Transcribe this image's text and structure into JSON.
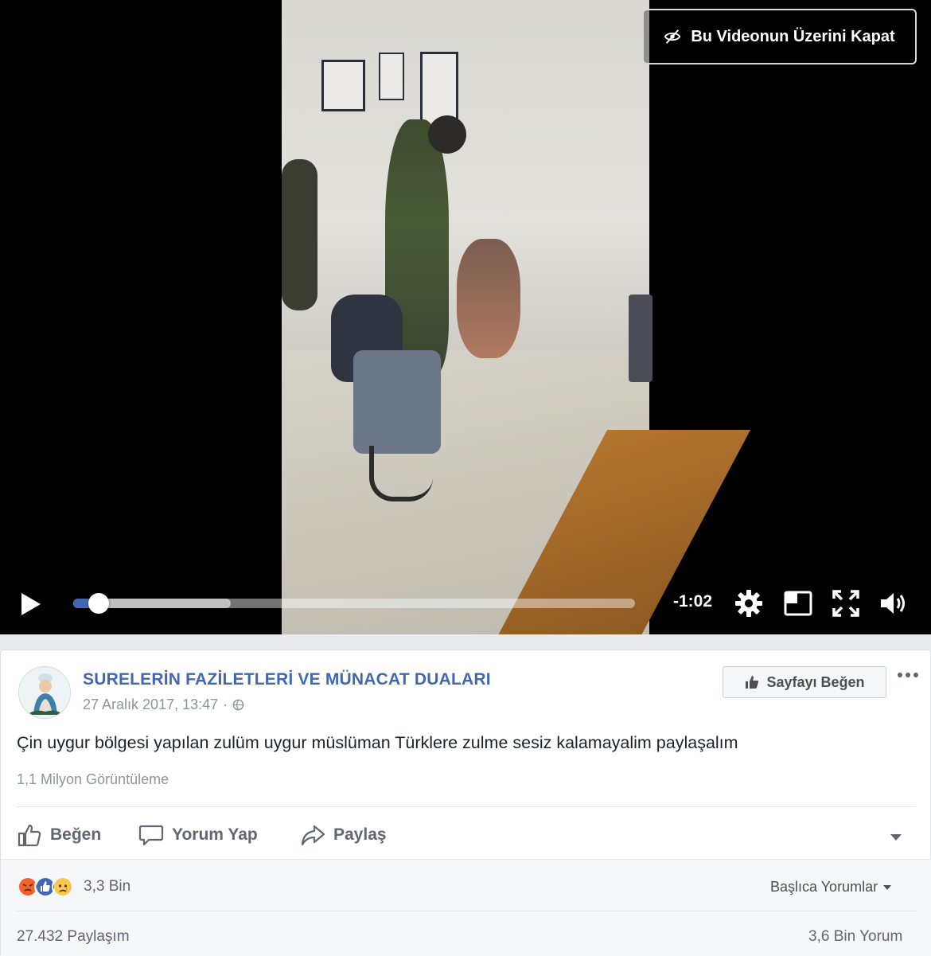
{
  "video": {
    "hide_label": "Bu Videonun Üzerini Kapat",
    "remaining_time": "-1:02",
    "progress_fraction": 0.045,
    "buffered_fraction": 0.28,
    "controls": [
      "play-icon",
      "gear-icon",
      "pip-icon",
      "fullscreen-icon",
      "volume-icon"
    ]
  },
  "post": {
    "page_name": "SURELERİN FAZİLETLERİ VE MÜNACAT DUALARI",
    "date": "27 Aralık 2017, 13:47",
    "meta_separator": "·",
    "like_page_label": "Sayfayı Beğen",
    "text": "Çin uygur bölgesi yapılan zulüm uygur müslüman Türklere zulme sesiz kalamayalim paylaşalım",
    "views": "1,1 Milyon Görüntüleme"
  },
  "actions": {
    "like": "Beğen",
    "comment": "Yorum Yap",
    "share": "Paylaş"
  },
  "footer": {
    "reaction_icons": [
      "angry-icon",
      "like-icon",
      "sad-icon"
    ],
    "reaction_count": "3,3 Bin",
    "top_comments": "Başlıca Yorumlar",
    "shares": "27.432 Paylaşım",
    "comments": "3,6 Bin Yorum"
  },
  "colors": {
    "accent": "#4267b2",
    "angry": "#f0642c",
    "sad": "#f7c94c"
  }
}
